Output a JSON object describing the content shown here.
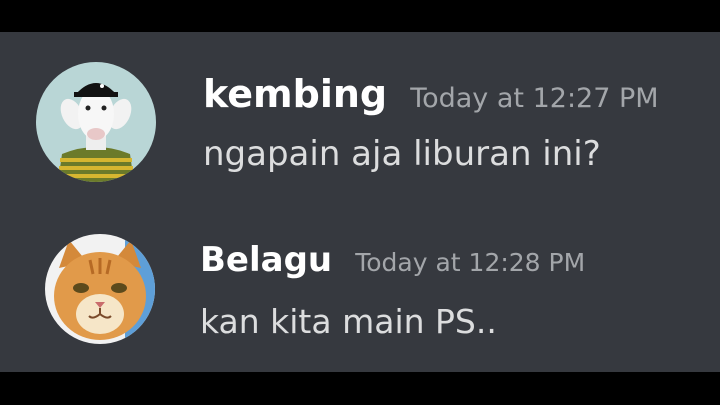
{
  "messages": [
    {
      "username": "kembing",
      "timestamp": "Today at 12:27 PM",
      "text": "ngapain aja liburan ini?",
      "avatar": "goat-avatar-icon"
    },
    {
      "username": "Belagu",
      "timestamp": "Today at 12:28 PM",
      "text": "kan kita main PS..",
      "avatar": "cat-avatar-icon"
    }
  ],
  "colors": {
    "chat_background": "#36393f",
    "username": "#ffffff",
    "timestamp": "#a3a6aa",
    "message_text": "#dcddde",
    "letterbox": "#000000"
  }
}
